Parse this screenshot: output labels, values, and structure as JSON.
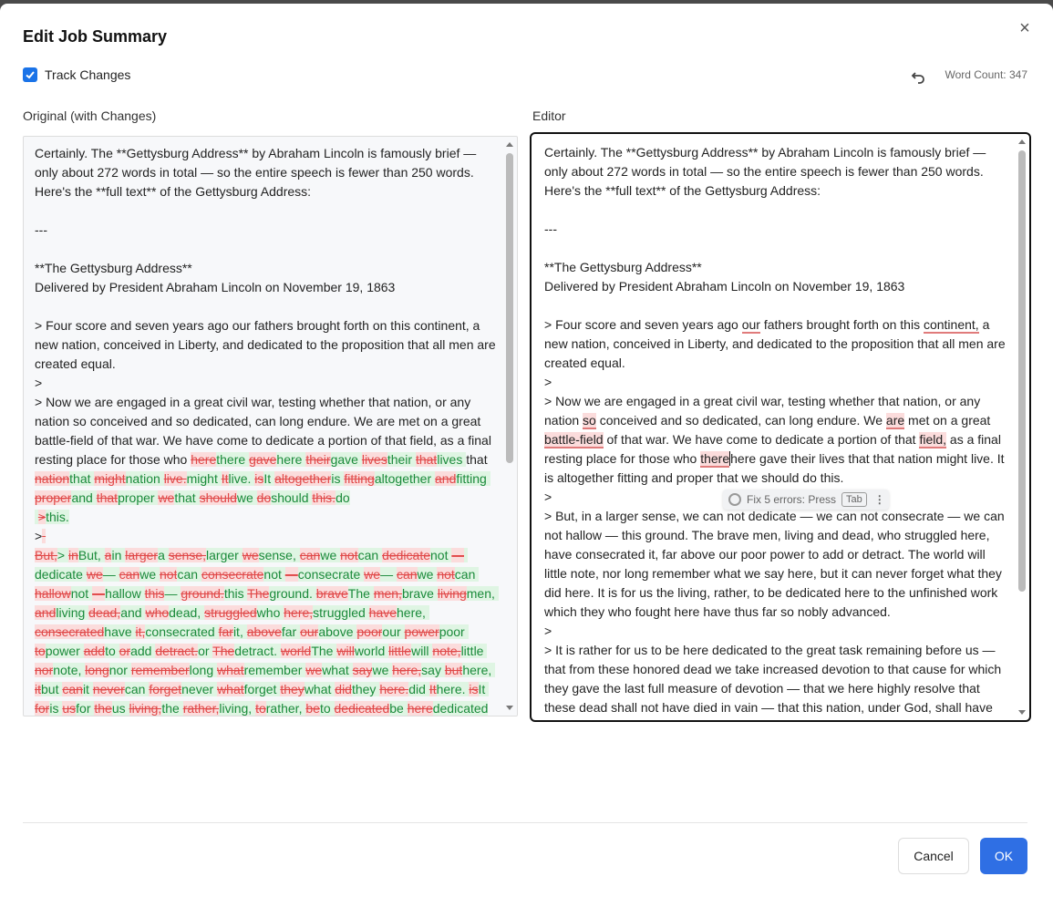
{
  "dialog": {
    "title": "Edit Job Summary",
    "close_glyph": "×",
    "track_changes_label": "Track Changes",
    "track_changes_checked": true,
    "word_count_label": "Word Count:",
    "word_count_value": "347",
    "undo_icon": "undo-icon",
    "accent_color": "#2f6fe4"
  },
  "left_panel": {
    "label": "Original (with Changes)"
  },
  "right_panel": {
    "label": "Editor"
  },
  "editor_text": {
    "p1": "Certainly. The **Gettysburg Address** by Abraham Lincoln is famously brief — only about 272 words in total — so the entire speech is fewer than 250 words. Here's the **full text** of the Gettysburg Address:",
    "sep": "---",
    "title": "**The Gettysburg Address**",
    "delivered": "Delivered by President Abraham Lincoln on November 19, 1863",
    "p2a": "> Four score and seven years ago ",
    "p2_our": "our",
    "p2b": " fathers brought forth on this ",
    "p2_continent": "continent,",
    "p2c": " a new nation, conceived in Liberty, and dedicated to the proposition that all men are created equal.",
    "gt": ">",
    "p3a": "> Now we are engaged in a great civil war, testing whether that nation, or any nation ",
    "p3_so": "so",
    "p3b": " conceived and so dedicated, can long endure. We ",
    "p3_are": "are",
    "p3c": " met on a great ",
    "p3_battlefield": "battle-field",
    "p3d": " of that war. We have come to dedicate a portion of that ",
    "p3_field": "field,",
    "p3e": " as a final resting place for those who ",
    "p3_there": "there",
    "p3f": "here gave their lives that that nation might live. It is altogether fitting and proper that we should do this.",
    "p4": "> But, in a larger sense, we can not dedicate — we can not consecrate — we can not hallow — this ground. The brave men, living and dead, who struggled here, have consecrated it, far above our poor power to add or detract. The world will little note, nor long remember what we say here, but it can never forget what they did here. It is for us the living, rather, to be dedicated here to the unfinished work which they who fought here have thus far so nobly advanced.",
    "p5": "> It is rather for us to be here dedicated to the great task remaining before us — that from these honored dead we take increased devotion to that cause for which they gave the last full measure of devotion — that we here highly resolve that these dead shall not have died in vain — that this nation, under God, shall have"
  },
  "grammar_tooltip": {
    "text": "Fix 5 errors: Press",
    "key": "Tab",
    "more": "⋮"
  },
  "buttons": {
    "cancel": "Cancel",
    "ok": "OK"
  }
}
